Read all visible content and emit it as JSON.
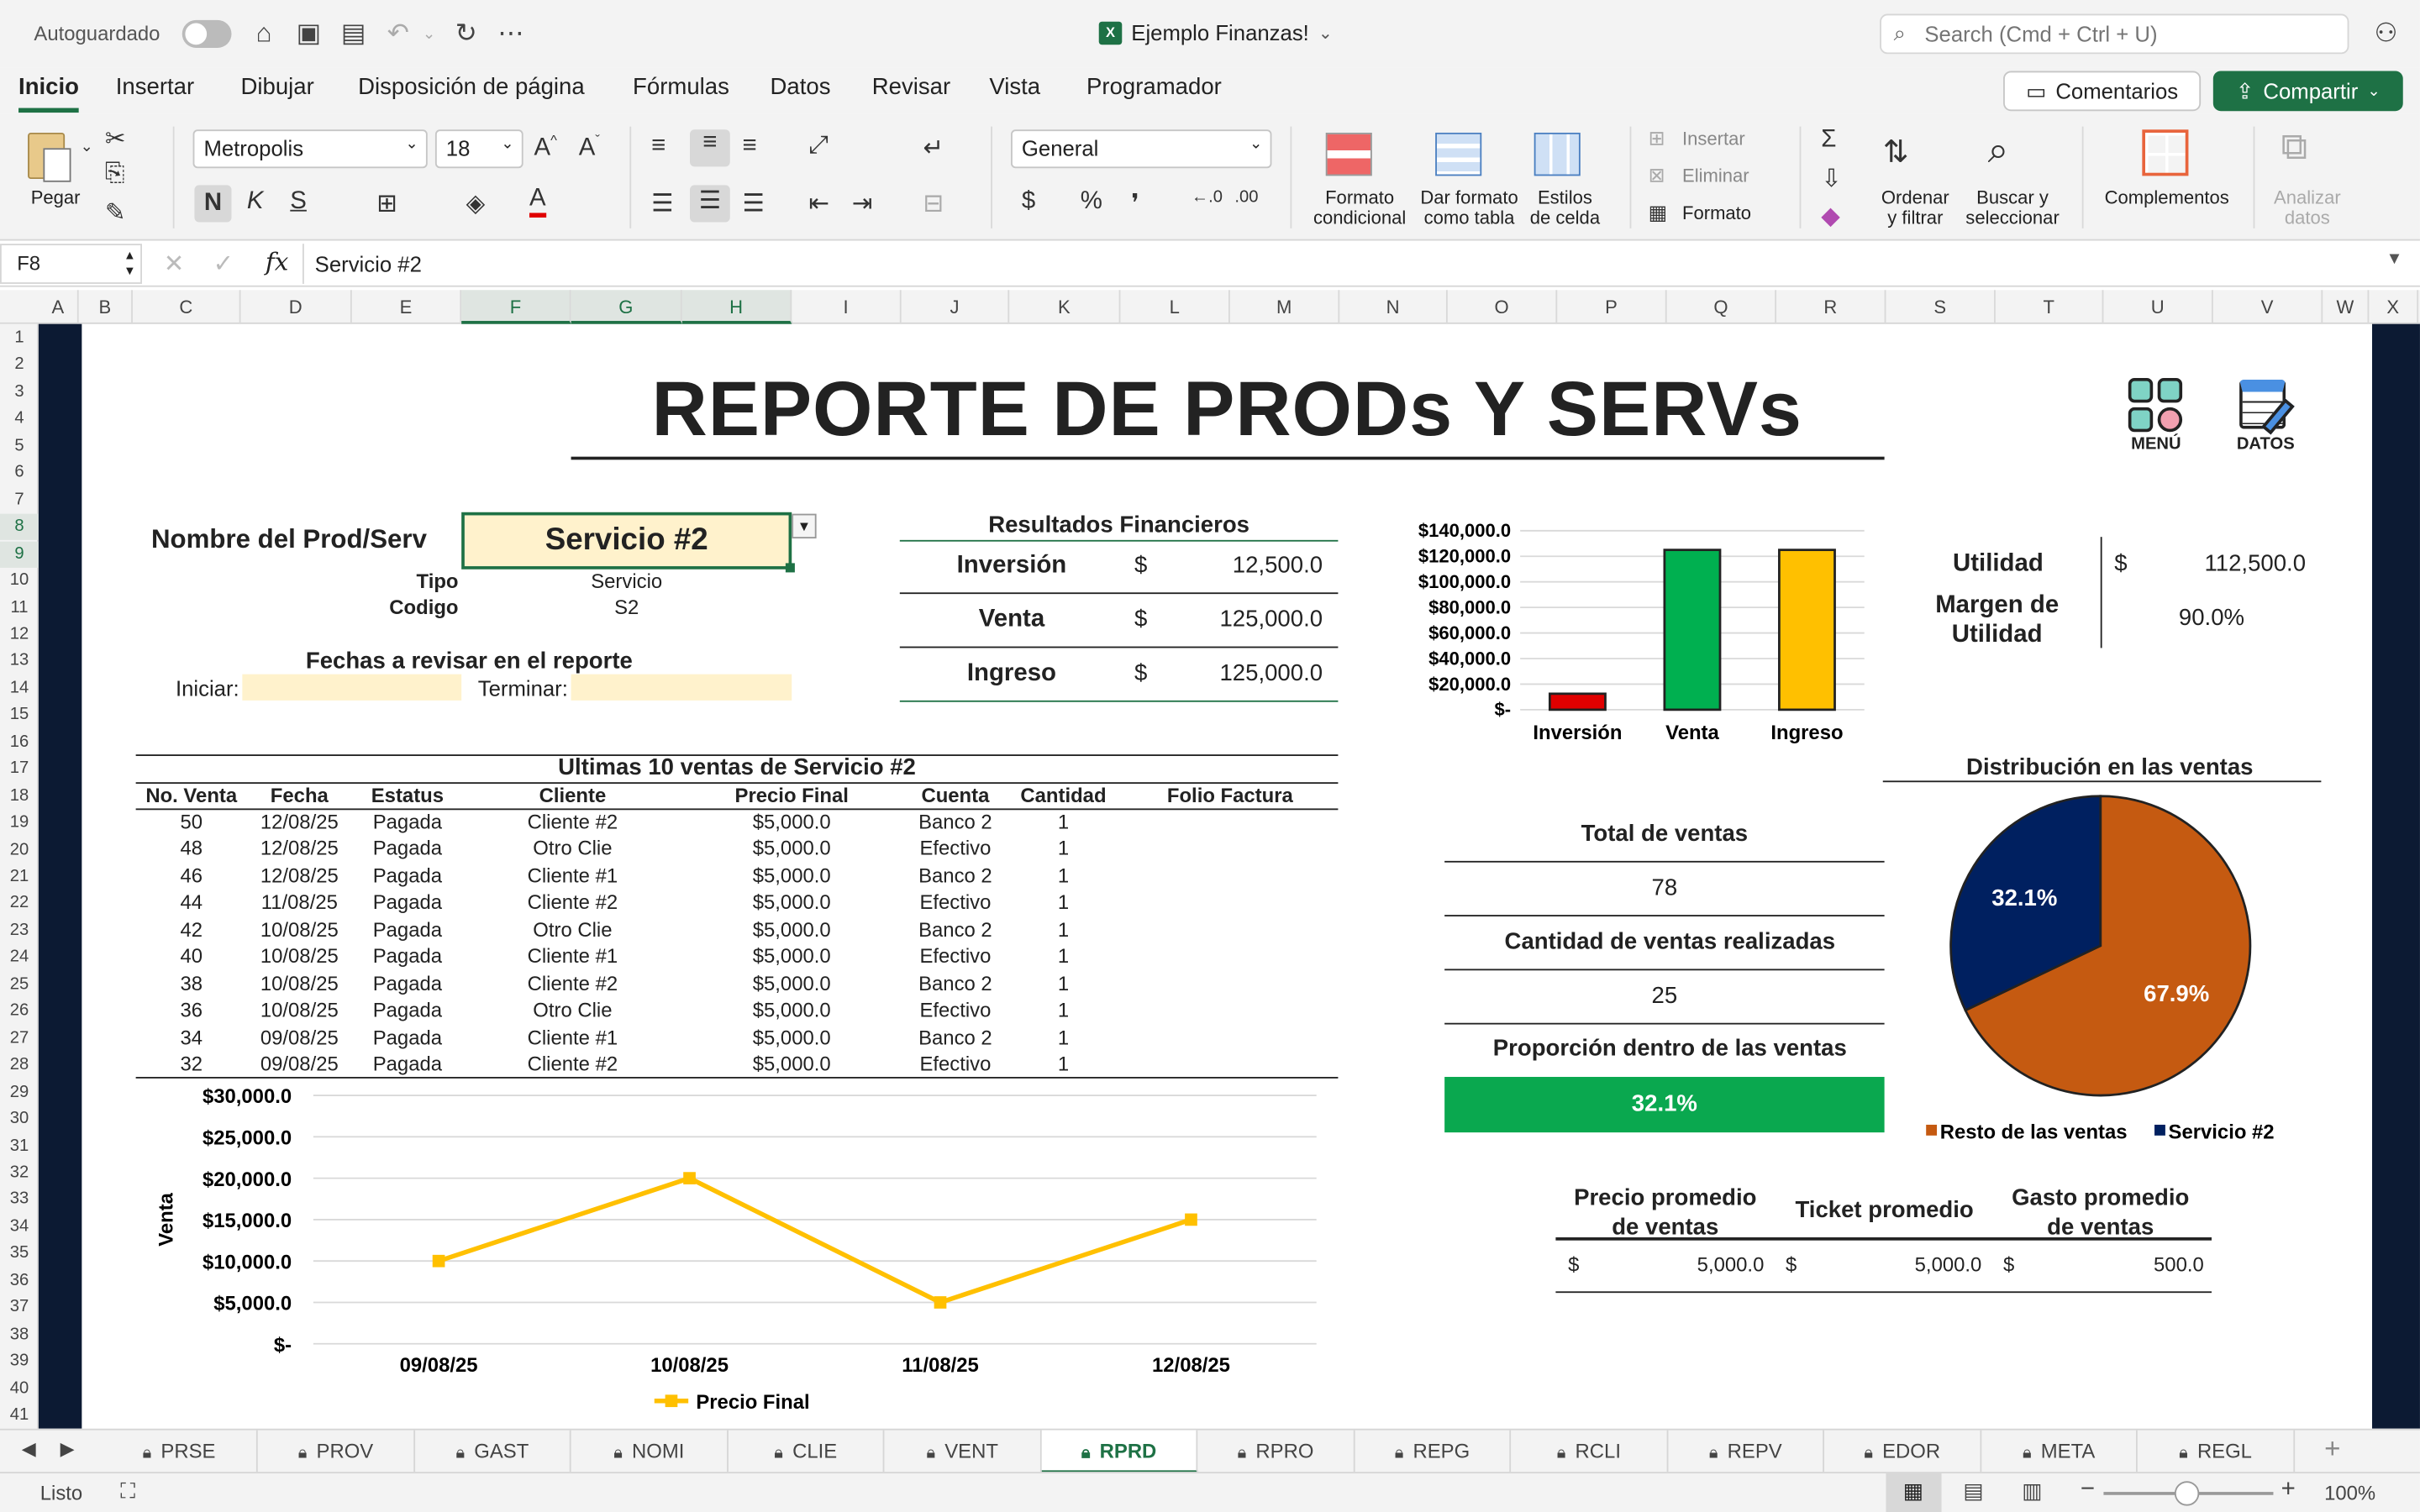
{
  "titlebar": {
    "autosave": "Autoguardado",
    "filename": "Ejemplo Finanzas!",
    "search_placeholder": "Search (Cmd + Ctrl + U)"
  },
  "ribbon_tabs": [
    "Inicio",
    "Insertar",
    "Dibujar",
    "Disposición de página",
    "Fórmulas",
    "Datos",
    "Revisar",
    "Vista",
    "Programador"
  ],
  "ribbon_buttons": {
    "comments": "Comentarios",
    "share": "Compartir"
  },
  "ribbon": {
    "paste": "Pegar",
    "font": "Metropolis",
    "size": "18",
    "number_format": "General",
    "bold": "N",
    "italic": "K",
    "underline": "S",
    "cond_format": "Formato condicional",
    "table_format": "Dar formato como tabla",
    "cell_styles": "Estilos de celda",
    "insert": "Insertar",
    "delete": "Eliminar",
    "format": "Formato",
    "sort": "Ordenar y filtrar",
    "find": "Buscar y seleccionar",
    "addins": "Complementos",
    "analyze": "Analizar datos"
  },
  "formula_bar": {
    "cell": "F8",
    "fx": "fx",
    "value": "Servicio #2"
  },
  "columns": [
    "A",
    "B",
    "C",
    "D",
    "E",
    "F",
    "G",
    "H",
    "I",
    "J",
    "K",
    "L",
    "M",
    "N",
    "O",
    "P",
    "Q",
    "R",
    "S",
    "T",
    "U",
    "V",
    "W",
    "X"
  ],
  "rows": [
    "1",
    "2",
    "3",
    "4",
    "5",
    "6",
    "7",
    "8",
    "9",
    "10",
    "11",
    "12",
    "13",
    "14",
    "15",
    "16",
    "17",
    "18",
    "19",
    "20",
    "21",
    "22",
    "23",
    "24",
    "25",
    "26",
    "27",
    "28",
    "29",
    "30",
    "31",
    "32",
    "33",
    "34",
    "35",
    "36",
    "37",
    "38",
    "39",
    "40",
    "41"
  ],
  "report": {
    "title": "REPORTE DE PRODs Y SERVs",
    "menu": "MENÚ",
    "datos": "DATOS",
    "prod_label": "Nombre del Prod/Serv",
    "prod_value": "Servicio #2",
    "tipo_label": "Tipo",
    "tipo_value": "Servicio",
    "codigo_label": "Codigo",
    "codigo_value": "S2",
    "dates_title": "Fechas a revisar en el reporte",
    "start": "Iniciar:",
    "end": "Terminar:"
  },
  "financials": {
    "title": "Resultados Financieros",
    "rows": [
      {
        "label": "Inversión",
        "cur": "$",
        "value": "12,500.0"
      },
      {
        "label": "Venta",
        "cur": "$",
        "value": "125,000.0"
      },
      {
        "label": "Ingreso",
        "cur": "$",
        "value": "125,000.0"
      }
    ]
  },
  "utilidad": {
    "label": "Utilidad",
    "cur": "$",
    "value": "112,500.0",
    "margin_label_1": "Margen de",
    "margin_label_2": "Utilidad",
    "margin_value": "90.0%"
  },
  "bar_chart": {
    "type": "bar",
    "categories": [
      "Inversión",
      "Venta",
      "Ingreso"
    ],
    "values": [
      12500,
      125000,
      125000
    ],
    "colors": [
      "#e00000",
      "#00b050",
      "#ffc000"
    ],
    "ylim": [
      0,
      140000
    ],
    "yticks": [
      "$140,000.0",
      "$120,000.0",
      "$100,000.0",
      "$80,000.0",
      "$60,000.0",
      "$40,000.0",
      "$20,000.0",
      "$-"
    ]
  },
  "sales_table": {
    "title": "Ultimas 10 ventas de Servicio #2",
    "headers": [
      "No. Venta",
      "Fecha",
      "Estatus",
      "Cliente",
      "Precio Final",
      "Cuenta",
      "Cantidad",
      "Folio Factura"
    ],
    "rows": [
      [
        "50",
        "12/08/25",
        "Pagada",
        "Cliente #2",
        "$5,000.0",
        "Banco 2",
        "1",
        ""
      ],
      [
        "48",
        "12/08/25",
        "Pagada",
        "Otro Clie",
        "$5,000.0",
        "Efectivo",
        "1",
        ""
      ],
      [
        "46",
        "12/08/25",
        "Pagada",
        "Cliente #1",
        "$5,000.0",
        "Banco 2",
        "1",
        ""
      ],
      [
        "44",
        "11/08/25",
        "Pagada",
        "Cliente #2",
        "$5,000.0",
        "Efectivo",
        "1",
        ""
      ],
      [
        "42",
        "10/08/25",
        "Pagada",
        "Otro Clie",
        "$5,000.0",
        "Banco 2",
        "1",
        ""
      ],
      [
        "40",
        "10/08/25",
        "Pagada",
        "Cliente #1",
        "$5,000.0",
        "Efectivo",
        "1",
        ""
      ],
      [
        "38",
        "10/08/25",
        "Pagada",
        "Cliente #2",
        "$5,000.0",
        "Banco 2",
        "1",
        ""
      ],
      [
        "36",
        "10/08/25",
        "Pagada",
        "Otro Clie",
        "$5,000.0",
        "Efectivo",
        "1",
        ""
      ],
      [
        "34",
        "09/08/25",
        "Pagada",
        "Cliente #1",
        "$5,000.0",
        "Banco 2",
        "1",
        ""
      ],
      [
        "32",
        "09/08/25",
        "Pagada",
        "Cliente #2",
        "$5,000.0",
        "Efectivo",
        "1",
        ""
      ]
    ]
  },
  "line_chart": {
    "type": "line",
    "x": [
      "09/08/25",
      "10/08/25",
      "11/08/25",
      "12/08/25"
    ],
    "values": [
      10000,
      20000,
      5000,
      15000
    ],
    "ylim": [
      0,
      30000
    ],
    "yticks": [
      "$30,000.0",
      "$25,000.0",
      "$20,000.0",
      "$15,000.0",
      "$10,000.0",
      "$5,000.0",
      "$-"
    ],
    "ylabel": "Venta",
    "series_name": "Precio Final",
    "color": "#ffc000"
  },
  "totals": {
    "total_label": "Total de ventas",
    "total_value": "78",
    "count_label": "Cantidad de ventas realizadas",
    "count_value": "25",
    "prop_label": "Proporción dentro de las ventas",
    "prop_value": "32.1%"
  },
  "pie_chart": {
    "type": "pie",
    "title": "Distribución en las ventas",
    "labels": [
      "Resto de las ventas",
      "Servicio #2"
    ],
    "values": [
      67.9,
      32.1
    ],
    "value_labels": [
      "67.9%",
      "32.1%"
    ],
    "colors": [
      "#c55a11",
      "#002060"
    ]
  },
  "averages": {
    "h1a": "Precio promedio",
    "h1b": "de ventas",
    "h2": "Ticket promedio",
    "h3a": "Gasto promedio",
    "h3b": "de ventas",
    "v1": "5,000.0",
    "v2": "5,000.0",
    "v3": "500.0",
    "cur": "$"
  },
  "sheet_tabs": [
    "PRSE",
    "PROV",
    "GAST",
    "NOMI",
    "CLIE",
    "VENT",
    "RPRD",
    "RPRO",
    "REPG",
    "RCLI",
    "REPV",
    "EDOR",
    "META",
    "REGL"
  ],
  "active_sheet": "RPRD",
  "status": {
    "ready": "Listo",
    "zoom": "100%"
  }
}
